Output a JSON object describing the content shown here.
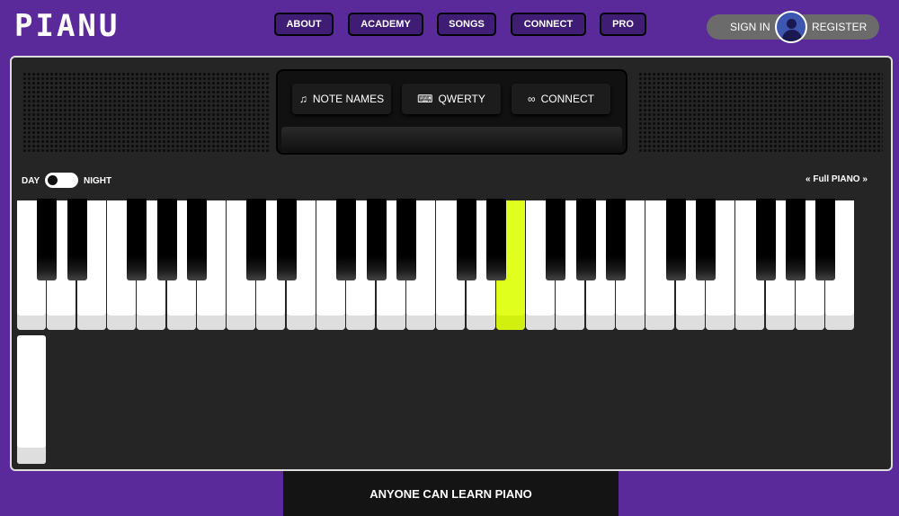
{
  "header": {
    "logo": "PIANU",
    "nav": [
      "ABOUT",
      "ACADEMY",
      "SONGS",
      "CONNECT",
      "PRO"
    ],
    "sign_in": "SIGN IN",
    "register": "REGISTER"
  },
  "console": {
    "buttons": [
      {
        "icon": "music-note-icon",
        "glyph": "♫",
        "label": "NOTE NAMES"
      },
      {
        "icon": "keyboard-icon",
        "glyph": "⌨",
        "label": "QWERTY"
      },
      {
        "icon": "link-icon",
        "glyph": "∞",
        "label": "CONNECT"
      }
    ]
  },
  "toggle": {
    "day": "DAY",
    "night": "NIGHT"
  },
  "mode": {
    "label": "Full PIANO",
    "prev": "«",
    "next": "»"
  },
  "keyboard": {
    "white_key_count": 28,
    "active_white_key": 16
  },
  "footer": {
    "tagline": "ANYONE CAN LEARN PIANO"
  }
}
